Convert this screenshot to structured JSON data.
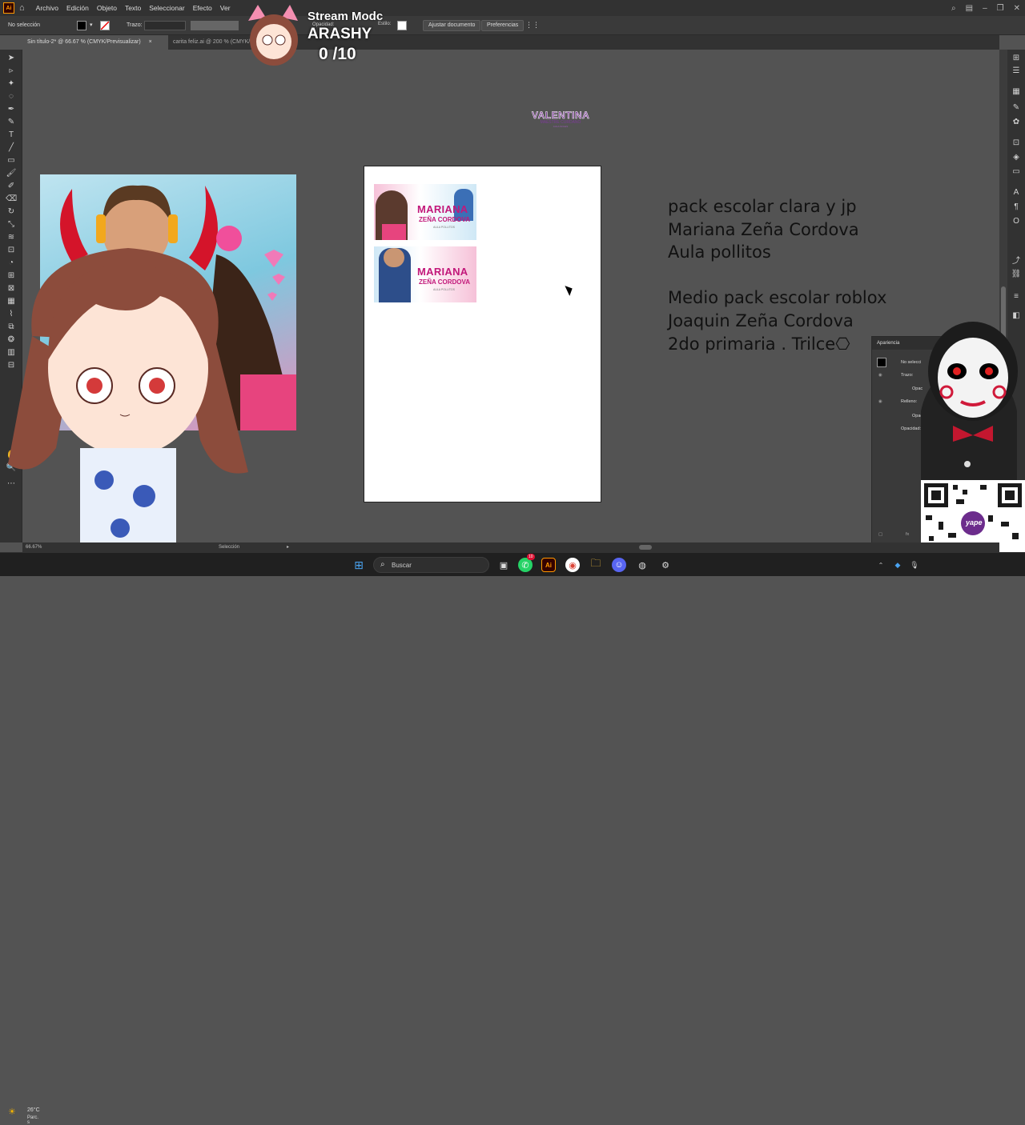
{
  "menubar": {
    "items": [
      "Archivo",
      "Edición",
      "Objeto",
      "Texto",
      "Seleccionar",
      "Efecto",
      "Ver"
    ]
  },
  "control_bar": {
    "selection": "No selección",
    "stroke_label": "Trazo:",
    "opacity_label": "Opacidad:",
    "style_label": "Estilo:",
    "fit_document": "Ajustar documento",
    "preferences": "Preferencias",
    "fill_color": "#000000"
  },
  "tabs": [
    {
      "label": "Sin título-2* @ 66.67 % (CMYK/Previsualizar)",
      "close": "×"
    },
    {
      "label": "carita feliz.ai @ 200 % (CMYK/"
    }
  ],
  "canvas": {
    "valentina": {
      "title": "VALENTINA",
      "subtitle": "MAESTRE CURDANO",
      "small": "AULA SOLES"
    },
    "thumbnails": [
      {
        "title": "MARIANA",
        "subtitle": "ZEÑA CORDOVA",
        "tag": "AULA POLLITOS"
      },
      {
        "title": "MARIANA",
        "subtitle": "ZEÑA CORDOVA",
        "tag": "AULA POLLITOS"
      }
    ],
    "notes": [
      "pack escolar  clara y jp",
      "Mariana Zeña Cordova",
      "Aula pollitos",
      "",
      "Medio pack escolar roblox",
      "Joaquin Zeña Cordova",
      "2do primaria . Trilce⎔"
    ]
  },
  "appearance_panel": {
    "title": "Apariencia",
    "no_selection": "No selecci",
    "stroke": "Trazo:",
    "opacity": "Opac",
    "fill": "Relleno:",
    "opacity2": "Opacidad",
    "opacity3": "Opacidad:"
  },
  "status_bar": {
    "zoom": "66.67%",
    "mode": "Selección"
  },
  "stream_overlay": {
    "line1": "Stream Modc",
    "line2": "ARASHY",
    "line3": "0  /10"
  },
  "taskbar": {
    "weather_temp": "26°C",
    "weather_desc": "Parc. s",
    "search_placeholder": "Buscar",
    "whatsapp_badge": "10"
  },
  "qr": {
    "brand": "yape"
  },
  "colors": {
    "accent": "#ff9a00",
    "canvas_bg": "#535353",
    "panel_bg": "#323232",
    "pink": "#c2187a"
  }
}
